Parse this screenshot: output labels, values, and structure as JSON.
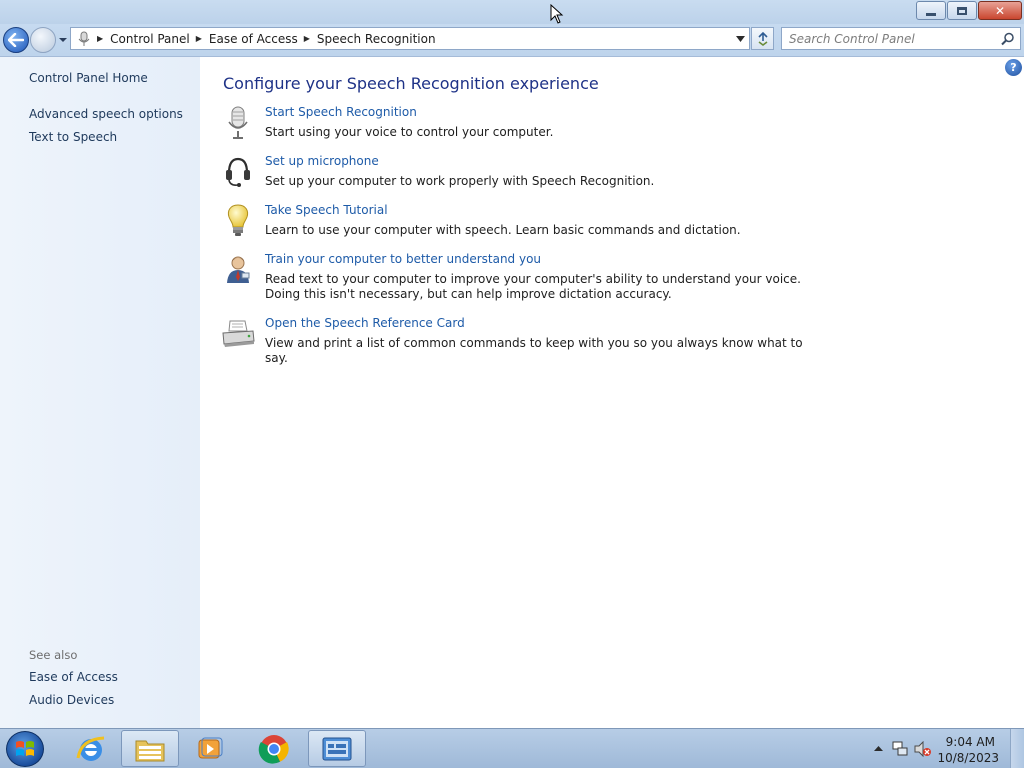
{
  "window": {
    "caption_buttons": {
      "minimize_icon": "minimize-icon",
      "maximize_icon": "restore-icon",
      "close_glyph": "✕"
    }
  },
  "addressbar": {
    "crumbs": [
      "Control Panel",
      "Ease of Access",
      "Speech Recognition"
    ],
    "search_placeholder": "Search Control Panel"
  },
  "sidebar": {
    "home_label": "Control Panel Home",
    "links": [
      "Advanced speech options",
      "Text to Speech"
    ],
    "see_also_heading": "See also",
    "see_also_links": [
      "Ease of Access",
      "Audio Devices"
    ]
  },
  "main": {
    "title": "Configure your Speech Recognition experience",
    "help_glyph": "?",
    "tasks": [
      {
        "icon": "microphone-icon",
        "link": "Start Speech Recognition",
        "description": "Start using your voice to control your computer."
      },
      {
        "icon": "headset-icon",
        "link": "Set up microphone",
        "description": "Set up your computer to work properly with Speech Recognition."
      },
      {
        "icon": "lightbulb-icon",
        "link": "Take Speech Tutorial",
        "description": "Learn to use your computer with speech.  Learn basic commands and dictation."
      },
      {
        "icon": "user-training-icon",
        "link": "Train your computer to better understand you",
        "description": "Read text to your computer to improve your computer's ability to understand your voice.  Doing this isn't necessary, but can help improve dictation accuracy."
      },
      {
        "icon": "printer-icon",
        "link": "Open the Speech Reference Card",
        "description": "View and print a list of common commands to keep with you so you always know what to say."
      }
    ]
  },
  "taskbar": {
    "apps": [
      "internet-explorer-icon",
      "file-explorer-icon",
      "media-player-icon",
      "chrome-icon",
      "control-panel-icon"
    ],
    "active_app": "control-panel-icon",
    "clock_time": "9:04 AM",
    "clock_date": "10/8/2023"
  },
  "colors": {
    "link": "#1e5ba8",
    "title": "#1e3287",
    "sidebar_bg": "#eef4fb"
  }
}
